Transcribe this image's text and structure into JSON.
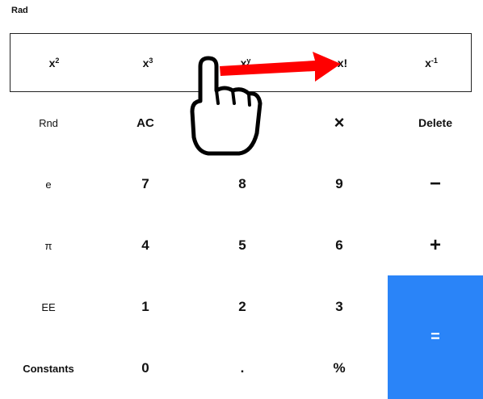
{
  "header": {
    "mode_label": "Rad"
  },
  "function_row": {
    "x_squared": {
      "base": "x",
      "exp": "2"
    },
    "x_cubed": {
      "base": "x",
      "exp": "3"
    },
    "x_pow_y": {
      "base": "x",
      "exp": "y"
    },
    "factorial": "x!",
    "x_inverse": {
      "base": "x",
      "exp": "-1"
    }
  },
  "keypad": {
    "rnd": "Rnd",
    "ac": "AC",
    "multiply": "×",
    "delete": "Delete",
    "e": "e",
    "seven": "7",
    "eight": "8",
    "nine": "9",
    "minus": "−",
    "pi": "π",
    "four": "4",
    "five": "5",
    "six": "6",
    "plus": "+",
    "ee": "EE",
    "one": "1",
    "two": "2",
    "three": "3",
    "equals": "=",
    "constants": "Constants",
    "zero": "0",
    "decimal": ".",
    "percent": "%"
  },
  "annotation": {
    "arrow_color": "#ff0000",
    "hand_fill": "#ffffff",
    "hand_stroke": "#000000"
  }
}
